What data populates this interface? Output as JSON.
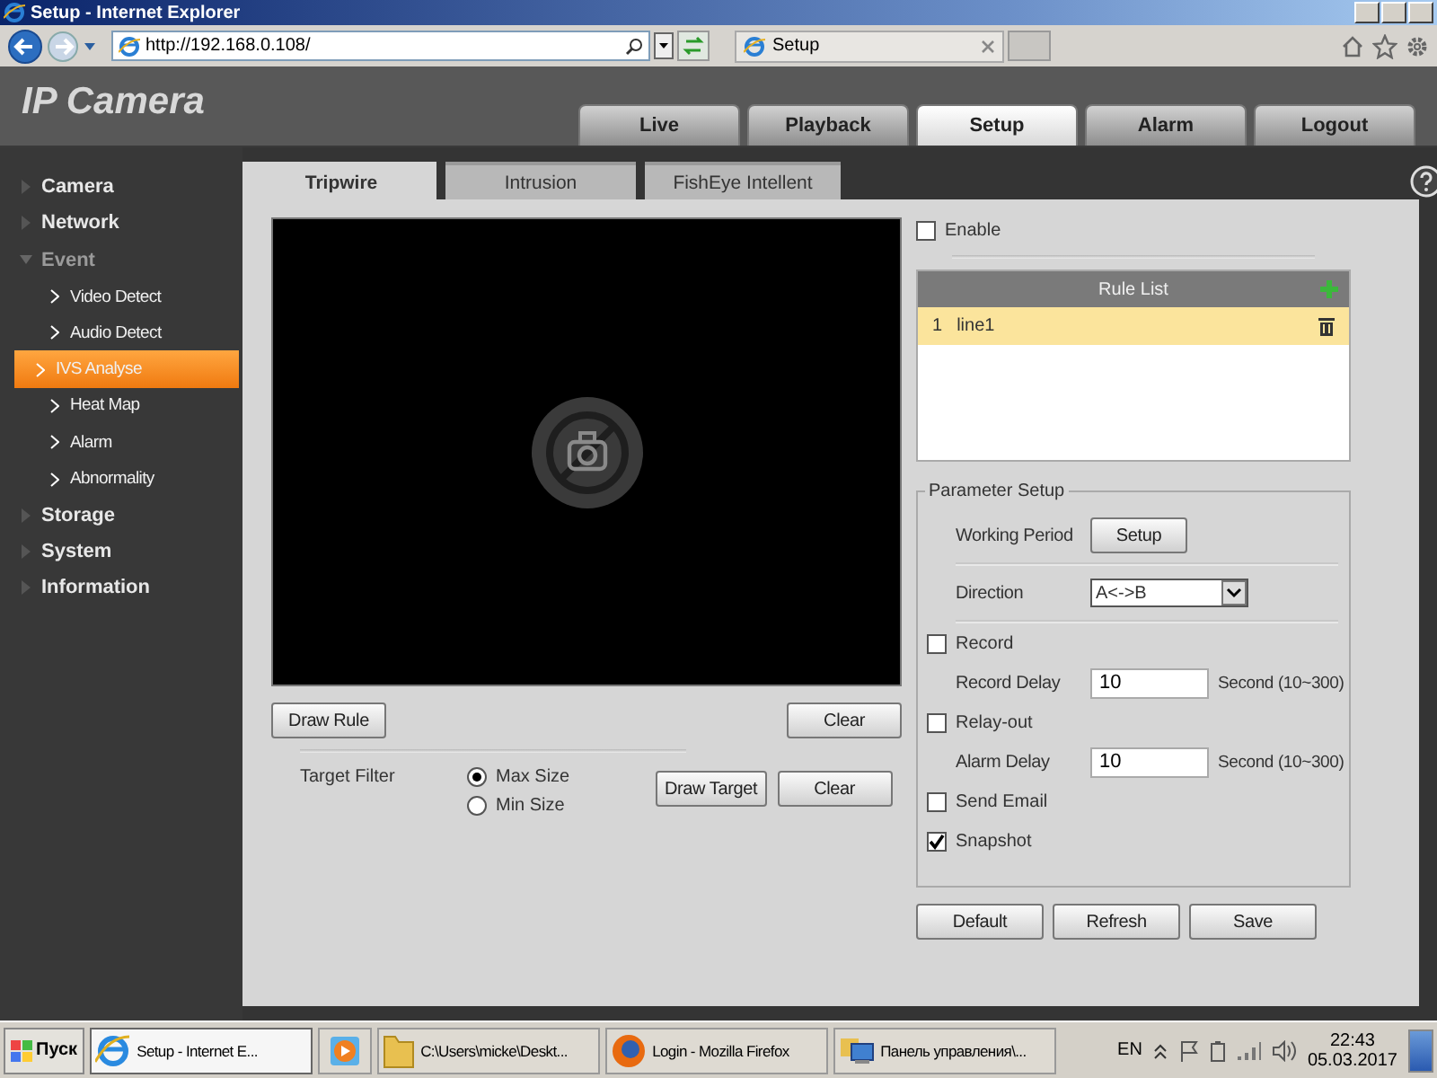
{
  "browser": {
    "title": "Setup - Internet Explorer",
    "address": "http://192.168.0.108/",
    "tab": "Setup"
  },
  "app": {
    "logo": "IP Camera",
    "nav": [
      {
        "label": "Live",
        "selected": false
      },
      {
        "label": "Playback",
        "selected": false
      },
      {
        "label": "Setup",
        "selected": true
      },
      {
        "label": "Alarm",
        "selected": false
      },
      {
        "label": "Logout",
        "selected": false
      }
    ]
  },
  "sidebar": {
    "items": [
      {
        "label": "Camera",
        "expanded": false
      },
      {
        "label": "Network",
        "expanded": false
      },
      {
        "label": "Event",
        "expanded": true,
        "children": [
          {
            "label": "Video Detect",
            "selected": false
          },
          {
            "label": "Audio Detect",
            "selected": false
          },
          {
            "label": "IVS Analyse",
            "selected": true
          },
          {
            "label": "Heat Map",
            "selected": false
          },
          {
            "label": "Alarm",
            "selected": false
          },
          {
            "label": "Abnormality",
            "selected": false
          }
        ]
      },
      {
        "label": "Storage",
        "expanded": false
      },
      {
        "label": "System",
        "expanded": false
      },
      {
        "label": "Information",
        "expanded": false
      }
    ]
  },
  "tabs": [
    {
      "label": "Tripwire",
      "selected": true
    },
    {
      "label": "Intrusion",
      "selected": false
    },
    {
      "label": "FishEye Intellent",
      "selected": false
    }
  ],
  "rule_buttons": [
    "Draw Rule",
    "Clear"
  ],
  "target_filter": {
    "label": "Target Filter",
    "options": [
      {
        "label": "Max Size",
        "selected": true
      },
      {
        "label": "Min Size",
        "selected": false
      }
    ],
    "buttons": [
      "Draw Target",
      "Clear"
    ]
  },
  "enable": {
    "label": "Enable",
    "checked": false
  },
  "rule_list": {
    "title": "Rule List",
    "rows": [
      {
        "index": "1",
        "name": "line1",
        "selected": true
      }
    ]
  },
  "parameter_setup": {
    "legend": "Parameter Setup",
    "rows": [
      {
        "kind": "button",
        "label": "Working Period",
        "button": "Setup"
      },
      {
        "kind": "select",
        "label": "Direction",
        "value": "A<->B"
      },
      {
        "kind": "check",
        "label": "Record",
        "checked": false
      },
      {
        "kind": "input",
        "label": "Record Delay",
        "value": "10",
        "unit": "Second (10~300)"
      },
      {
        "kind": "check",
        "label": "Relay-out",
        "checked": false
      },
      {
        "kind": "input",
        "label": "Alarm Delay",
        "value": "10",
        "unit": "Second (10~300)"
      },
      {
        "kind": "check",
        "label": "Send Email",
        "checked": false
      },
      {
        "kind": "check",
        "label": "Snapshot",
        "checked": true
      }
    ]
  },
  "footer_buttons": [
    "Default",
    "Refresh",
    "Save"
  ],
  "taskbar": {
    "start": "Пуск",
    "items": [
      {
        "kind": "ie",
        "label": "Setup - Internet E...",
        "selected": true
      },
      {
        "kind": "media",
        "selected": false
      },
      {
        "kind": "folder",
        "label": "C:\\Users\\micke\\Deskt...",
        "selected": false
      },
      {
        "kind": "firefox",
        "label": "Login - Mozilla Firefox",
        "selected": false
      },
      {
        "kind": "control",
        "label": "Панель управления\\...",
        "selected": false
      }
    ],
    "language": "EN",
    "time": "22:43",
    "date": "05.03.2017"
  }
}
